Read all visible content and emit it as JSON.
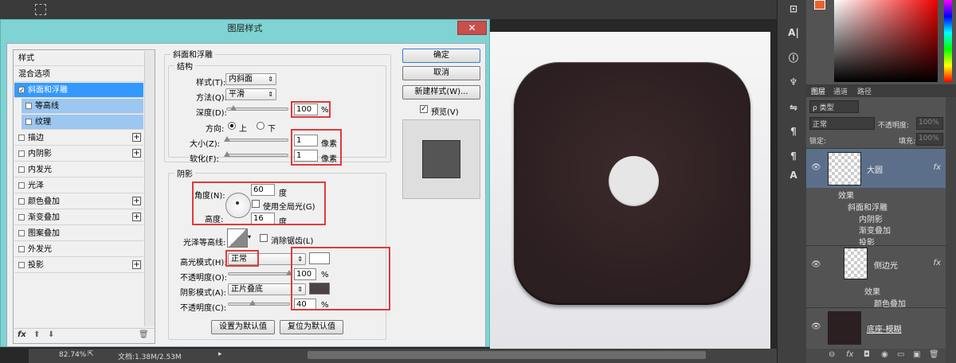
{
  "dialog": {
    "title": "图层样式",
    "close_glyph": "✕",
    "styles_list": [
      {
        "label": "样式",
        "checkbox": false,
        "plus": false,
        "state": "normal"
      },
      {
        "label": "混合选项",
        "checkbox": false,
        "plus": false,
        "state": "normal"
      },
      {
        "label": "斜面和浮雕",
        "checkbox": true,
        "checked": true,
        "plus": false,
        "state": "selected"
      },
      {
        "label": "等高线",
        "checkbox": true,
        "checked": false,
        "plus": false,
        "state": "sub"
      },
      {
        "label": "纹理",
        "checkbox": true,
        "checked": false,
        "plus": false,
        "state": "sub"
      },
      {
        "label": "描边",
        "checkbox": true,
        "checked": false,
        "plus": true,
        "state": "normal"
      },
      {
        "label": "内阴影",
        "checkbox": true,
        "checked": false,
        "plus": true,
        "state": "normal"
      },
      {
        "label": "内发光",
        "checkbox": true,
        "checked": false,
        "plus": false,
        "state": "normal"
      },
      {
        "label": "光泽",
        "checkbox": true,
        "checked": false,
        "plus": false,
        "state": "normal"
      },
      {
        "label": "颜色叠加",
        "checkbox": true,
        "checked": false,
        "plus": true,
        "state": "normal"
      },
      {
        "label": "渐变叠加",
        "checkbox": true,
        "checked": false,
        "plus": true,
        "state": "normal"
      },
      {
        "label": "图案叠加",
        "checkbox": true,
        "checked": false,
        "plus": false,
        "state": "normal"
      },
      {
        "label": "外发光",
        "checkbox": true,
        "checked": false,
        "plus": false,
        "state": "normal"
      },
      {
        "label": "投影",
        "checkbox": true,
        "checked": false,
        "plus": true,
        "state": "normal"
      }
    ],
    "footer": {
      "fx": "fx",
      "up": "⬆",
      "down": "⬇",
      "trash": "🗑"
    },
    "bevel": {
      "section_title": "斜面和浮雕",
      "structure_title": "结构",
      "style_label": "样式(T):",
      "style_value": "内斜面",
      "technique_label": "方法(Q):",
      "technique_value": "平滑",
      "depth_label": "深度(D):",
      "depth_value": "100",
      "depth_unit": "%",
      "depth_slider": 0.1,
      "direction_label": "方向:",
      "direction_up": "上",
      "direction_down": "下",
      "direction_selected": "上",
      "size_label": "大小(Z):",
      "size_value": "1",
      "size_unit": "像素",
      "size_slider": 0.0,
      "soften_label": "软化(F):",
      "soften_value": "1",
      "soften_unit": "像素",
      "soften_slider": 0.0
    },
    "shading": {
      "section_title": "阴影",
      "angle_label": "角度(N):",
      "angle_value": "60",
      "angle_unit": "度",
      "global_light_label": "使用全局光(G)",
      "global_light_checked": false,
      "altitude_label": "高度:",
      "altitude_value": "16",
      "altitude_unit": "度",
      "gloss_label": "光泽等高线:",
      "antialias_label": "消除锯齿(L)",
      "antialias_checked": false,
      "highlight_mode_label": "高光模式(H):",
      "highlight_mode_value": "正常",
      "highlight_color": "#ffffff",
      "highlight_opacity_label": "不透明度(O):",
      "highlight_opacity_value": "100",
      "highlight_opacity_unit": "%",
      "highlight_opacity_slider": 1.0,
      "shadow_mode_label": "阴影模式(A):",
      "shadow_mode_value": "正片叠底",
      "shadow_color": "#4a4244",
      "shadow_opacity_label": "不透明度(C):",
      "shadow_opacity_value": "40",
      "shadow_opacity_unit": "%",
      "shadow_opacity_slider": 0.4
    },
    "buttons": {
      "set_default": "设置为默认值",
      "reset_default": "复位为默认值",
      "ok": "确定",
      "cancel": "取消",
      "new_style": "新建样式(W)...",
      "preview_label": "预览(V)",
      "preview_checked": true
    },
    "preview_color": "#555555"
  },
  "statusbar": {
    "zoom": "82.74%",
    "doc": "文档:1.38M/2.53M"
  },
  "layers_panel": {
    "tabs": [
      "图层",
      "通道",
      "路径"
    ],
    "filter_label": "ρ 类型",
    "blend_mode": "正常",
    "opacity_label": "不透明度:",
    "opacity_value": "100%",
    "lock_label": "锁定:",
    "fill_label": "填充:",
    "fill_value": "100%",
    "layers": [
      {
        "name": "大圆",
        "selected": true,
        "fx": "fx",
        "effects_title": "效果",
        "effects": [
          "斜面和浮雕",
          "内阴影",
          "渐变叠加",
          "投影"
        ]
      },
      {
        "name": "侧边光",
        "selected": false,
        "fx": "fx",
        "effects_title": "效果",
        "effects": [
          "颜色叠加"
        ]
      },
      {
        "name": "底座-模糊",
        "selected": false,
        "fx": "",
        "effects_title": "",
        "effects": []
      }
    ],
    "footer_icons": [
      "⊖",
      "fx",
      "◘",
      "◉",
      "▭",
      "▣",
      "🗑"
    ]
  },
  "colors": {
    "accent_selected": "#3399ff",
    "dialog_frame": "#7fd3d3",
    "annotation_red": "#e03a3a",
    "foreground_color": "#f0602c"
  },
  "tool_icons": [
    "shape-tool-icon",
    "type-tool-icon",
    "info-icon",
    "brush-icon",
    "adjust-icon",
    "paragraph-icon",
    "char-style-icon",
    "swatch-icon"
  ],
  "tool_glyphs": [
    "⊡",
    "A|",
    "ⓘ",
    "♆",
    "⇋",
    "¶",
    "¶",
    "A"
  ]
}
